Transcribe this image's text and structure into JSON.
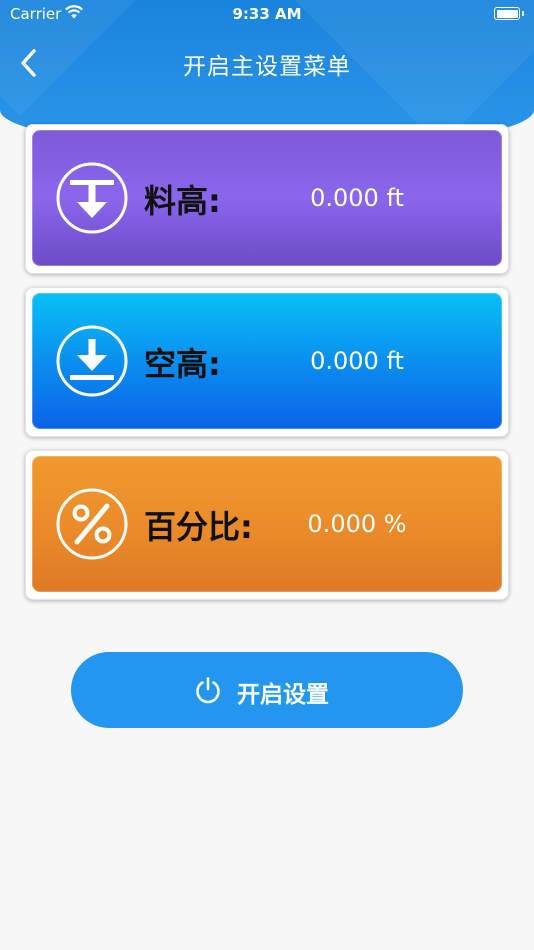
{
  "status_bar": {
    "carrier": "Carrier",
    "time": "9:33 AM"
  },
  "nav": {
    "title": "开启主设置菜单",
    "back_icon": "chevron-left-icon"
  },
  "cards": [
    {
      "label": "料高:",
      "value": "0.000 ft",
      "icon": "material-level-icon",
      "color": "#8463e2"
    },
    {
      "label": "空高:",
      "value": "0.000 ft",
      "icon": "empty-height-icon",
      "color": "#0a8ff0"
    },
    {
      "label": "百分比:",
      "value": "0.000 %",
      "icon": "percent-icon",
      "color": "#eb8c2a"
    }
  ],
  "start_button": {
    "label": "开启设置",
    "icon": "power-icon",
    "color": "#2396ef"
  }
}
